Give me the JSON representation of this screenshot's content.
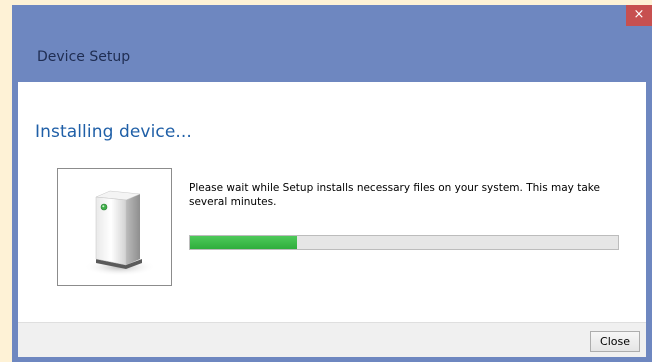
{
  "window": {
    "title": "Device Setup",
    "close_glyph": "×"
  },
  "main": {
    "heading": "Installing device...",
    "message": "Please wait while Setup installs necessary files on your system. This may take several minutes.",
    "device_icon": "device-icon",
    "progress": 0.25
  },
  "footer": {
    "close_label": "Close"
  },
  "colors": {
    "window_frame": "#6e87c0",
    "heading": "#1f5fa7",
    "progress_fill": "#3cbc49",
    "close_x_bg": "#c75050"
  }
}
